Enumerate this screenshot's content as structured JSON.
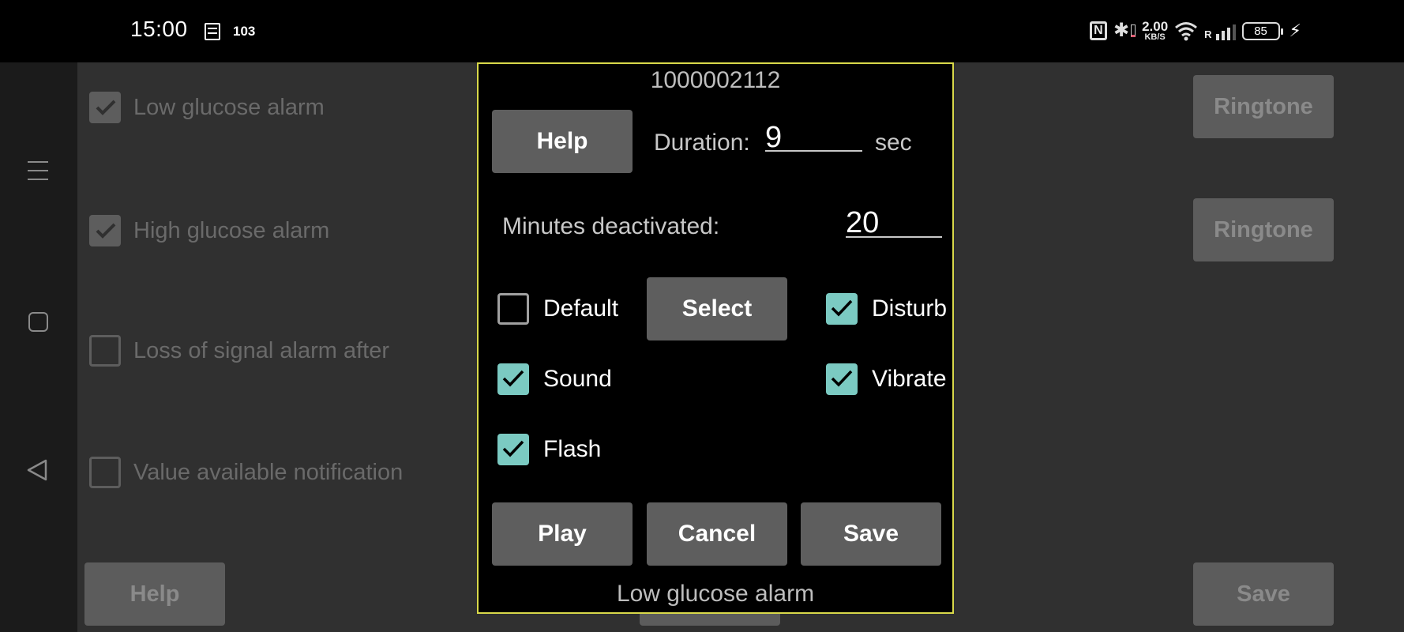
{
  "status_bar": {
    "time": "15:00",
    "notification_count": "103",
    "network_speed_value": "2.00",
    "network_speed_unit": "KB/S",
    "roaming": "R",
    "battery_level": "85",
    "icons": [
      "notification-list-icon",
      "nfc-icon",
      "bluetooth-icon",
      "wifi-icon",
      "signal-icon",
      "battery-icon",
      "charging-icon"
    ]
  },
  "nav": {
    "icons": [
      "menu-icon",
      "home-icon",
      "back-icon"
    ]
  },
  "background": {
    "options": [
      {
        "label": "Low glucose alarm",
        "checked": true
      },
      {
        "label": "High glucose alarm",
        "checked": true
      },
      {
        "label": "Loss of signal alarm after",
        "checked": false
      },
      {
        "label": "Value available notification",
        "checked": false
      }
    ],
    "ringtone_button_1": "Ringtone",
    "ringtone_button_2": "Ringtone",
    "help_button": "Help",
    "save_button": "Save"
  },
  "dialog": {
    "title": "1000002112",
    "help_button": "Help",
    "duration_label": "Duration:",
    "duration_value": "9",
    "duration_unit": "sec",
    "minutes_label": "Minutes deactivated:",
    "minutes_value": "20",
    "select_button": "Select",
    "checkboxes": {
      "default": {
        "label": "Default",
        "checked": false
      },
      "disturb": {
        "label": "Disturb",
        "checked": true
      },
      "sound": {
        "label": "Sound",
        "checked": true
      },
      "vibrate": {
        "label": "Vibrate",
        "checked": true
      },
      "flash": {
        "label": "Flash",
        "checked": true
      }
    },
    "play_button": "Play",
    "cancel_button": "Cancel",
    "save_button": "Save",
    "footer": "Low glucose alarm",
    "border_color": "#d9d94a",
    "accent_color": "#7bcac2"
  }
}
